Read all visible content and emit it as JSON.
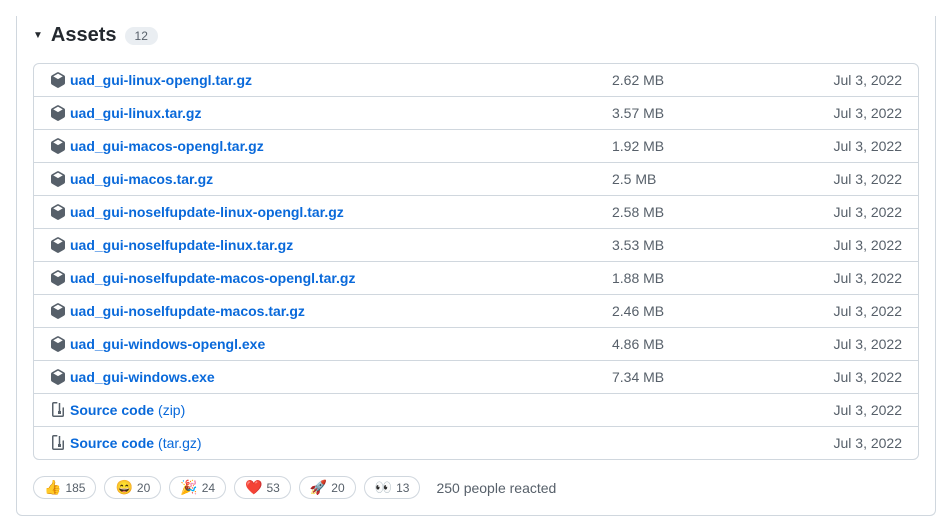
{
  "header": {
    "title": "Assets",
    "count": "12"
  },
  "assets": [
    {
      "icon": "package",
      "name": "uad_gui-linux-opengl.tar.gz",
      "size": "2.62 MB",
      "date": "Jul 3, 2022"
    },
    {
      "icon": "package",
      "name": "uad_gui-linux.tar.gz",
      "size": "3.57 MB",
      "date": "Jul 3, 2022"
    },
    {
      "icon": "package",
      "name": "uad_gui-macos-opengl.tar.gz",
      "size": "1.92 MB",
      "date": "Jul 3, 2022"
    },
    {
      "icon": "package",
      "name": "uad_gui-macos.tar.gz",
      "size": "2.5 MB",
      "date": "Jul 3, 2022"
    },
    {
      "icon": "package",
      "name": "uad_gui-noselfupdate-linux-opengl.tar.gz",
      "size": "2.58 MB",
      "date": "Jul 3, 2022"
    },
    {
      "icon": "package",
      "name": "uad_gui-noselfupdate-linux.tar.gz",
      "size": "3.53 MB",
      "date": "Jul 3, 2022"
    },
    {
      "icon": "package",
      "name": "uad_gui-noselfupdate-macos-opengl.tar.gz",
      "size": "1.88 MB",
      "date": "Jul 3, 2022"
    },
    {
      "icon": "package",
      "name": "uad_gui-noselfupdate-macos.tar.gz",
      "size": "2.46 MB",
      "date": "Jul 3, 2022"
    },
    {
      "icon": "package",
      "name": "uad_gui-windows-opengl.exe",
      "size": "4.86 MB",
      "date": "Jul 3, 2022"
    },
    {
      "icon": "package",
      "name": "uad_gui-windows.exe",
      "size": "7.34 MB",
      "date": "Jul 3, 2022"
    },
    {
      "icon": "zip",
      "name": "Source code",
      "suffix": " (zip)",
      "size": "",
      "date": "Jul 3, 2022"
    },
    {
      "icon": "zip",
      "name": "Source code",
      "suffix": " (tar.gz)",
      "size": "",
      "date": "Jul 3, 2022"
    }
  ],
  "reactions": [
    {
      "emoji": "👍",
      "count": "185"
    },
    {
      "emoji": "😄",
      "count": "20"
    },
    {
      "emoji": "🎉",
      "count": "24"
    },
    {
      "emoji": "❤️",
      "count": "53"
    },
    {
      "emoji": "🚀",
      "count": "20"
    },
    {
      "emoji": "👀",
      "count": "13"
    }
  ],
  "reaction_summary": "250 people reacted"
}
